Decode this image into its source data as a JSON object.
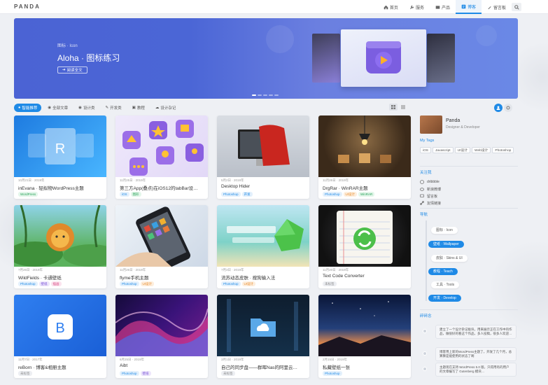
{
  "app": {
    "logo": "PANDA"
  },
  "nav": {
    "items": [
      {
        "label": "首页",
        "icon": "home-icon"
      },
      {
        "label": "服务",
        "icon": "wrench-icon"
      },
      {
        "label": "产品",
        "icon": "product-icon"
      },
      {
        "label": "博客",
        "icon": "blog-icon",
        "active": true
      },
      {
        "label": "留言板",
        "icon": "pen-icon"
      }
    ],
    "search_icon": "search-icon"
  },
  "hero": {
    "subtitle": "图标 · Icon",
    "title": "Aloha · 图标练习",
    "button": "阅读全文"
  },
  "tabs": [
    {
      "label": "智能推荐",
      "active": true
    },
    {
      "label": "全部文章"
    },
    {
      "label": "设计类"
    },
    {
      "label": "开发类"
    },
    {
      "label": "教程"
    },
    {
      "label": "设计杂记"
    }
  ],
  "cards": [
    {
      "meta": "10月21日 · 2019年",
      "title": "inEvana · 轻拟物WordPress主题",
      "tags": [
        {
          "t": "WordPress",
          "c": "green"
        }
      ]
    },
    {
      "meta": "11月25日 · 2019年",
      "title": "第三方App(叠点)在iOS12的tabBar设…",
      "tags": [
        {
          "t": "iOS",
          "c": "blue"
        },
        {
          "t": "图形",
          "c": "green"
        }
      ]
    },
    {
      "meta": "5月2日 · 2019年",
      "title": "Desktop Hider",
      "tags": [
        {
          "t": "Photoshop",
          "c": "blue"
        },
        {
          "t": "开发",
          "c": "blue"
        }
      ]
    },
    {
      "meta": "11月26日 · 2019年",
      "title": "DrgRar · WinRAR主题",
      "tags": [
        {
          "t": "Photoshop",
          "c": "blue"
        },
        {
          "t": "UI设计",
          "c": "orange"
        },
        {
          "t": "WinRAR",
          "c": "green"
        }
      ]
    },
    {
      "meta": "7月26日 · 2019年",
      "title": "WildFields · 卡通壁纸",
      "tags": [
        {
          "t": "Photoshop",
          "c": "blue"
        },
        {
          "t": "壁纸",
          "c": "purple"
        },
        {
          "t": "插画",
          "c": "pink"
        }
      ]
    },
    {
      "meta": "11月26日 · 2019年",
      "title": "flyme手机主题",
      "tags": [
        {
          "t": "Photoshop",
          "c": "blue"
        },
        {
          "t": "UI设计",
          "c": "orange"
        }
      ]
    },
    {
      "meta": "7月3日 · 2019年",
      "title": "流苏动态皮肤 · 搜狗输入法",
      "tags": [
        {
          "t": "Photoshop",
          "c": "blue"
        },
        {
          "t": "UI设计",
          "c": "orange"
        }
      ]
    },
    {
      "meta": "11月20日 · 2019年",
      "title": "Text Code Converter",
      "tags": [
        {
          "t": "未标签",
          "c": "gray"
        }
      ]
    },
    {
      "meta": "11月7日 · 2017年",
      "title": "reBorn · 博客&相册主题",
      "tags": [
        {
          "t": "未标签",
          "c": "gray"
        }
      ]
    },
    {
      "meta": "6月25日 · 2019年",
      "title": "Aibt",
      "tags": [
        {
          "t": "Photoshop",
          "c": "blue"
        },
        {
          "t": "壁纸",
          "c": "purple"
        }
      ]
    },
    {
      "meta": "3月1日 · 2019年",
      "title": "自己的同步盘——群晖Nas的阿里云…",
      "tags": [
        {
          "t": "未标签",
          "c": "gray"
        }
      ]
    },
    {
      "meta": "2月15日 · 2019年",
      "title": "私藏壁纸一张",
      "tags": [
        {
          "t": "Photoshop",
          "c": "blue"
        }
      ]
    }
  ],
  "sidebar": {
    "name": "Panda",
    "role": "Designer & Developer",
    "tags_heading": "My Tags",
    "tags": [
      "iOS",
      "Javascript",
      "UI设计",
      "Web设计",
      "Photoshop"
    ],
    "follow_heading": "关注我",
    "follow": [
      {
        "label": "dribbble",
        "icon": "dribbble-icon"
      },
      {
        "label": "新浪微博",
        "icon": "weibo-icon"
      },
      {
        "label": "留言板",
        "icon": "message-icon"
      },
      {
        "label": "友情链接",
        "icon": "link-icon"
      }
    ],
    "nav_heading": "导航",
    "nav_items": [
      {
        "label": "图标 · Icon",
        "style": "white"
      },
      {
        "label": "壁纸 · Wallpaper",
        "style": "blue"
      },
      {
        "label": "皮肤 · Skins & UI",
        "style": "white"
      },
      {
        "label": "教程 · Teach",
        "style": "blue"
      },
      {
        "label": "工具 · Tools",
        "style": "white"
      },
      {
        "label": "开发 · Develop",
        "style": "blue"
      }
    ],
    "notes_heading": "碎碎念",
    "notes": [
      "建立了一个设计杂记板块，用来展示正在工作中的作品，做很好的看这个作品，多人投稿，很多人欢迎…",
      "博客用上新的WordPress主题了，开发了几个月，总算算是能使用的状态了啊",
      "主题现在支持 WordPress 5.0 版，只得用有的用户的文章编写了 Gutenberg 模块…"
    ]
  },
  "colors": {
    "accent": "#1f8ae6",
    "hero": "#4b63d4"
  }
}
